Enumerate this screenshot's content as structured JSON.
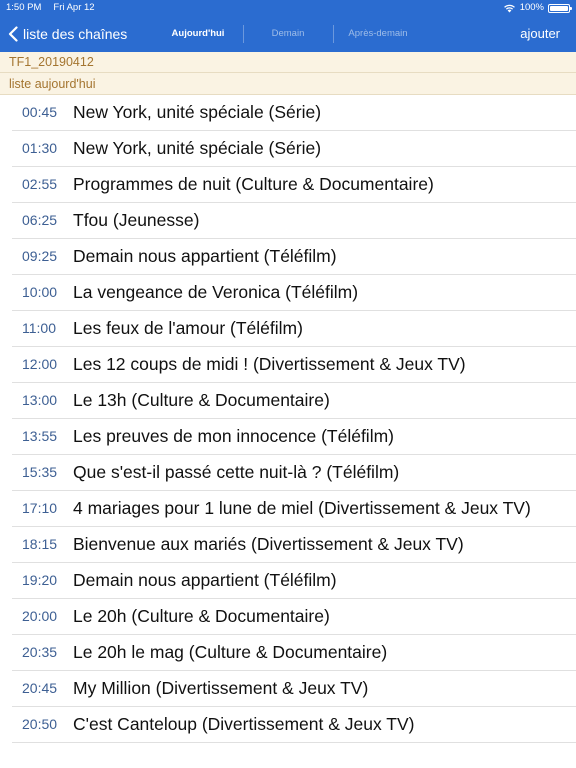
{
  "status_bar": {
    "time": "1:50 PM",
    "date": "Fri Apr 12",
    "battery": "100%",
    "battery_level": 100
  },
  "nav": {
    "back_label": "liste des chaînes",
    "segments": [
      {
        "label": "Aujourd'hui",
        "selected": true
      },
      {
        "label": "Demain",
        "selected": false
      },
      {
        "label": "Après-demain",
        "selected": false
      }
    ],
    "add_label": "ajouter"
  },
  "channel_header": "TF1_20190412",
  "list_header": "liste aujourd'hui",
  "programs": [
    {
      "time": "00:45",
      "title": "New York, unité spéciale  (Série)"
    },
    {
      "time": "01:30",
      "title": "New York, unité spéciale  (Série)"
    },
    {
      "time": "02:55",
      "title": "Programmes de nuit  (Culture & Documentaire)"
    },
    {
      "time": "06:25",
      "title": "Tfou  (Jeunesse)"
    },
    {
      "time": "09:25",
      "title": "Demain nous appartient  (Téléfilm)"
    },
    {
      "time": "10:00",
      "title": "La vengeance de Veronica  (Téléfilm)"
    },
    {
      "time": "11:00",
      "title": "Les feux de l'amour  (Téléfilm)"
    },
    {
      "time": "12:00",
      "title": "Les 12 coups de midi !  (Divertissement & Jeux TV)"
    },
    {
      "time": "13:00",
      "title": "Le 13h  (Culture & Documentaire)"
    },
    {
      "time": "13:55",
      "title": "Les preuves de mon innocence  (Téléfilm)"
    },
    {
      "time": "15:35",
      "title": "Que s'est-il passé cette nuit-là ?  (Téléfilm)"
    },
    {
      "time": "17:10",
      "title": "4 mariages pour 1 lune de miel  (Divertissement & Jeux TV)"
    },
    {
      "time": "18:15",
      "title": "Bienvenue aux mariés  (Divertissement & Jeux TV)"
    },
    {
      "time": "19:20",
      "title": "Demain nous appartient  (Téléfilm)"
    },
    {
      "time": "20:00",
      "title": "Le 20h  (Culture & Documentaire)"
    },
    {
      "time": "20:35",
      "title": "Le 20h le mag  (Culture & Documentaire)"
    },
    {
      "time": "20:45",
      "title": "My Million  (Divertissement & Jeux TV)"
    },
    {
      "time": "20:50",
      "title": "C'est Canteloup  (Divertissement & Jeux TV)"
    }
  ],
  "colors": {
    "nav_background": "#2b6cd0",
    "header_background": "#faf3e3",
    "header_text": "#a47530",
    "time_text": "#3d5f93"
  },
  "icons": {
    "back": "chevron-left-icon",
    "wifi": "wifi-icon",
    "battery": "battery-icon"
  }
}
